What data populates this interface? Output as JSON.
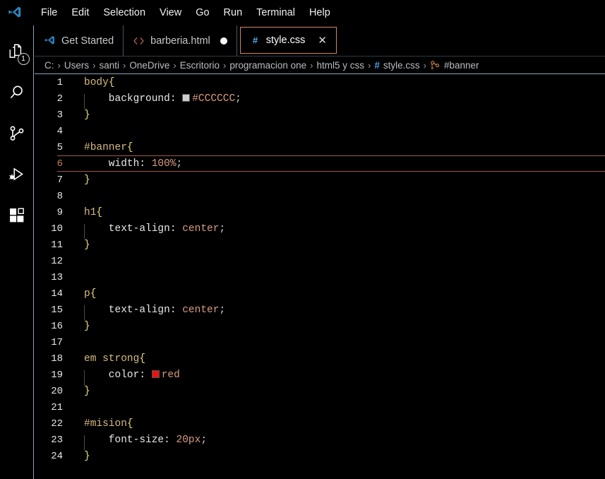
{
  "app": {
    "logo_icon": "vscode-logo-icon",
    "menu": [
      "File",
      "Edit",
      "Selection",
      "View",
      "Go",
      "Run",
      "Terminal",
      "Help"
    ]
  },
  "activitybar": {
    "items": [
      {
        "name": "explorer",
        "icon": "files-icon",
        "badge": "1"
      },
      {
        "name": "search",
        "icon": "search-icon",
        "badge": ""
      },
      {
        "name": "source-control",
        "icon": "branch-icon",
        "badge": ""
      },
      {
        "name": "run-debug",
        "icon": "run-debug-icon",
        "badge": ""
      },
      {
        "name": "extensions",
        "icon": "extensions-icon",
        "badge": ""
      }
    ]
  },
  "tabs": [
    {
      "label": "Get Started",
      "icon": "vscode-logo-icon",
      "active": false,
      "dirty": false,
      "closable": false
    },
    {
      "label": "barberia.html",
      "icon": "html-icon",
      "active": false,
      "dirty": true,
      "closable": false
    },
    {
      "label": "style.css",
      "icon": "css-hash-icon",
      "active": true,
      "dirty": false,
      "closable": true,
      "close_glyph": "✕"
    }
  ],
  "breadcrumbs": {
    "separator": "›",
    "items": [
      {
        "label": "C:",
        "icon": ""
      },
      {
        "label": "Users",
        "icon": ""
      },
      {
        "label": "santi",
        "icon": ""
      },
      {
        "label": "OneDrive",
        "icon": ""
      },
      {
        "label": "Escritorio",
        "icon": ""
      },
      {
        "label": "programacion one",
        "icon": ""
      },
      {
        "label": "html5 y css",
        "icon": ""
      },
      {
        "label": "style.css",
        "icon": "css-hash-icon"
      },
      {
        "label": "#banner",
        "icon": "css-selector-icon"
      }
    ]
  },
  "editor": {
    "filename": "style.css",
    "language": "css",
    "current_line": 6,
    "lines": [
      {
        "n": "1",
        "indent": false,
        "tokens": [
          {
            "t": "body",
            "c": "tok-sel"
          },
          {
            "t": "{",
            "c": "tok-brace"
          }
        ]
      },
      {
        "n": "2",
        "indent": true,
        "tokens": [
          {
            "t": "    background:",
            "c": "tok-prop"
          },
          {
            "t": " ",
            "c": "tok-punct"
          },
          {
            "t": "#CCCCCC",
            "c": "tok-val",
            "swatch": "#CCCCCC"
          },
          {
            "t": ";",
            "c": "tok-punct"
          }
        ]
      },
      {
        "n": "3",
        "indent": false,
        "tokens": [
          {
            "t": "}",
            "c": "tok-brace"
          }
        ]
      },
      {
        "n": "4",
        "indent": false,
        "tokens": []
      },
      {
        "n": "5",
        "indent": false,
        "tokens": [
          {
            "t": "#banner",
            "c": "tok-sel"
          },
          {
            "t": "{",
            "c": "tok-brace"
          }
        ]
      },
      {
        "n": "6",
        "indent": false,
        "tokens": [
          {
            "t": "    width:",
            "c": "tok-prop"
          },
          {
            "t": " ",
            "c": "tok-punct"
          },
          {
            "t": "100%",
            "c": "tok-num"
          },
          {
            "t": ";",
            "c": "tok-punct"
          }
        ]
      },
      {
        "n": "7",
        "indent": false,
        "tokens": [
          {
            "t": "}",
            "c": "tok-brace"
          }
        ]
      },
      {
        "n": "8",
        "indent": false,
        "tokens": []
      },
      {
        "n": "9",
        "indent": false,
        "tokens": [
          {
            "t": "h1",
            "c": "tok-sel"
          },
          {
            "t": "{",
            "c": "tok-brace"
          }
        ]
      },
      {
        "n": "10",
        "indent": true,
        "tokens": [
          {
            "t": "    text-align:",
            "c": "tok-prop"
          },
          {
            "t": " ",
            "c": "tok-punct"
          },
          {
            "t": "center",
            "c": "tok-val"
          },
          {
            "t": ";",
            "c": "tok-punct"
          }
        ]
      },
      {
        "n": "11",
        "indent": false,
        "tokens": [
          {
            "t": "}",
            "c": "tok-brace"
          }
        ]
      },
      {
        "n": "12",
        "indent": false,
        "tokens": []
      },
      {
        "n": "13",
        "indent": false,
        "tokens": []
      },
      {
        "n": "14",
        "indent": false,
        "tokens": [
          {
            "t": "p",
            "c": "tok-sel"
          },
          {
            "t": "{",
            "c": "tok-brace"
          }
        ]
      },
      {
        "n": "15",
        "indent": true,
        "tokens": [
          {
            "t": "    text-align:",
            "c": "tok-prop"
          },
          {
            "t": " ",
            "c": "tok-punct"
          },
          {
            "t": "center",
            "c": "tok-val"
          },
          {
            "t": ";",
            "c": "tok-punct"
          }
        ]
      },
      {
        "n": "16",
        "indent": false,
        "tokens": [
          {
            "t": "}",
            "c": "tok-brace"
          }
        ]
      },
      {
        "n": "17",
        "indent": false,
        "tokens": []
      },
      {
        "n": "18",
        "indent": false,
        "tokens": [
          {
            "t": "em strong",
            "c": "tok-sel"
          },
          {
            "t": "{",
            "c": "tok-brace"
          }
        ]
      },
      {
        "n": "19",
        "indent": true,
        "tokens": [
          {
            "t": "    color:",
            "c": "tok-prop"
          },
          {
            "t": " ",
            "c": "tok-punct"
          },
          {
            "t": "red",
            "c": "tok-val",
            "swatch": "#ee1111"
          }
        ]
      },
      {
        "n": "20",
        "indent": false,
        "tokens": [
          {
            "t": "}",
            "c": "tok-brace"
          }
        ]
      },
      {
        "n": "21",
        "indent": false,
        "tokens": []
      },
      {
        "n": "22",
        "indent": false,
        "tokens": [
          {
            "t": "#mision",
            "c": "tok-sel"
          },
          {
            "t": "{",
            "c": "tok-brace"
          }
        ]
      },
      {
        "n": "23",
        "indent": true,
        "tokens": [
          {
            "t": "    font-size:",
            "c": "tok-prop"
          },
          {
            "t": " ",
            "c": "tok-punct"
          },
          {
            "t": "20px",
            "c": "tok-num"
          },
          {
            "t": ";",
            "c": "tok-punct"
          }
        ]
      },
      {
        "n": "24",
        "indent": false,
        "tokens": [
          {
            "t": "}",
            "c": "tok-brace"
          }
        ]
      }
    ]
  },
  "colors": {
    "background": "#000000",
    "active_tab_border": "#d4836b",
    "current_line_border": "#9c5a48",
    "selector": "#d7ba7d",
    "brace": "#e6db74",
    "value": "#d99a80",
    "accent_blue": "#4a9fe0"
  }
}
